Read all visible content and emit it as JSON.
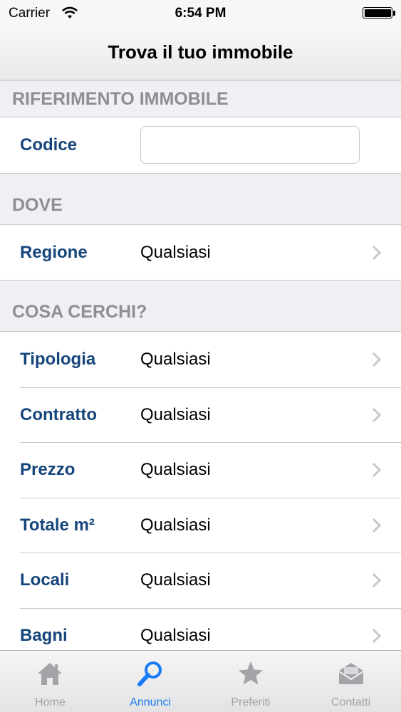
{
  "status_bar": {
    "carrier": "Carrier",
    "time": "6:54 PM"
  },
  "nav": {
    "title": "Trova il tuo immobile"
  },
  "sections": {
    "riferimento": {
      "header": "RIFERIMENTO IMMOBILE",
      "codice": {
        "label": "Codice",
        "value": "",
        "placeholder": ""
      }
    },
    "dove": {
      "header": "DOVE",
      "regione": {
        "label": "Regione",
        "value": "Qualsiasi"
      }
    },
    "cosa": {
      "header": "COSA CERCHI?",
      "rows": [
        {
          "label": "Tipologia",
          "value": "Qualsiasi"
        },
        {
          "label": "Contratto",
          "value": "Qualsiasi"
        },
        {
          "label": "Prezzo",
          "value": "Qualsiasi"
        },
        {
          "label": "Totale m²",
          "value": "Qualsiasi"
        },
        {
          "label": "Locali",
          "value": "Qualsiasi"
        },
        {
          "label": "Bagni",
          "value": "Qualsiasi"
        }
      ]
    }
  },
  "tabbar": {
    "items": [
      {
        "label": "Home",
        "icon": "house-icon"
      },
      {
        "label": "Annunci",
        "icon": "magnifier-icon",
        "active": true
      },
      {
        "label": "Preferiti",
        "icon": "star-icon"
      },
      {
        "label": "Contatti",
        "icon": "envelope-icon"
      }
    ]
  },
  "colors": {
    "label_blue": "#15457a",
    "active_tab": "#1a7cf4",
    "inactive_tab": "#a3a3a8",
    "section_header_text": "#8e8e93",
    "background": "#efeff4"
  }
}
